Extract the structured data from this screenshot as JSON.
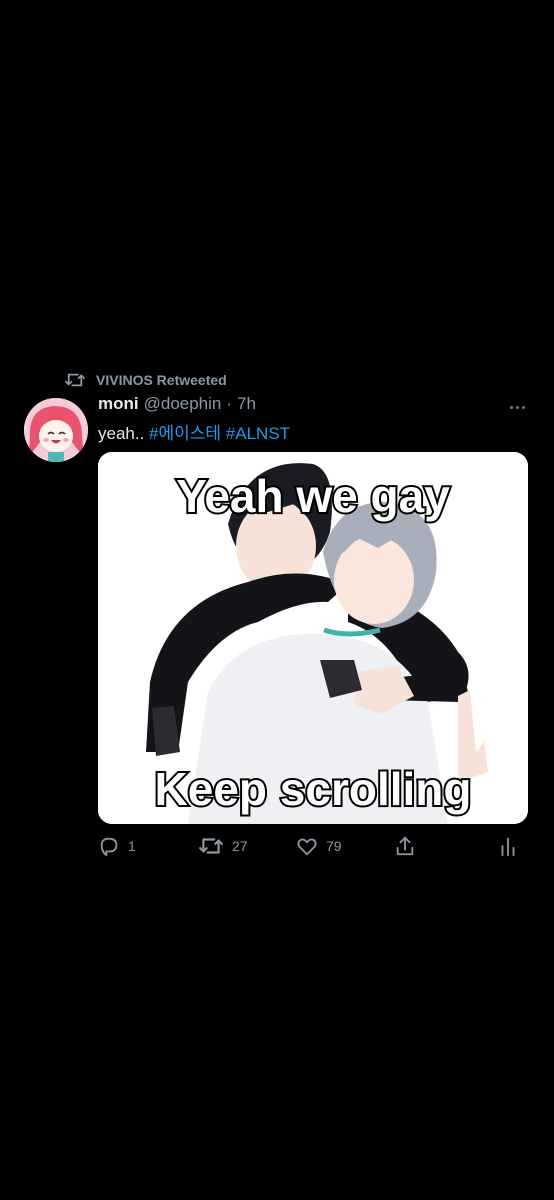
{
  "retweet": {
    "label": "VIVINOS Retweeted"
  },
  "tweet": {
    "name": "moni",
    "handle": "@doephin",
    "separator": "·",
    "time": "7h",
    "text_prefix": "yeah..",
    "hashtags": [
      "#에이스테",
      "#ALNST"
    ]
  },
  "media": {
    "top_caption": "Yeah we gay",
    "bottom_caption": "Keep scrolling"
  },
  "actions": {
    "reply_count": "1",
    "retweet_count": "27",
    "like_count": "79"
  },
  "icons": {
    "retweet_header": "retweet-icon",
    "reply": "reply-icon",
    "retweet": "retweet-icon",
    "like": "heart-icon",
    "share": "share-icon",
    "analytics": "analytics-icon",
    "more": "more-icon"
  },
  "colors": {
    "background": "#000000",
    "text": "#e7e9ea",
    "secondary": "#8b98a5",
    "link": "#1d9bf0"
  }
}
